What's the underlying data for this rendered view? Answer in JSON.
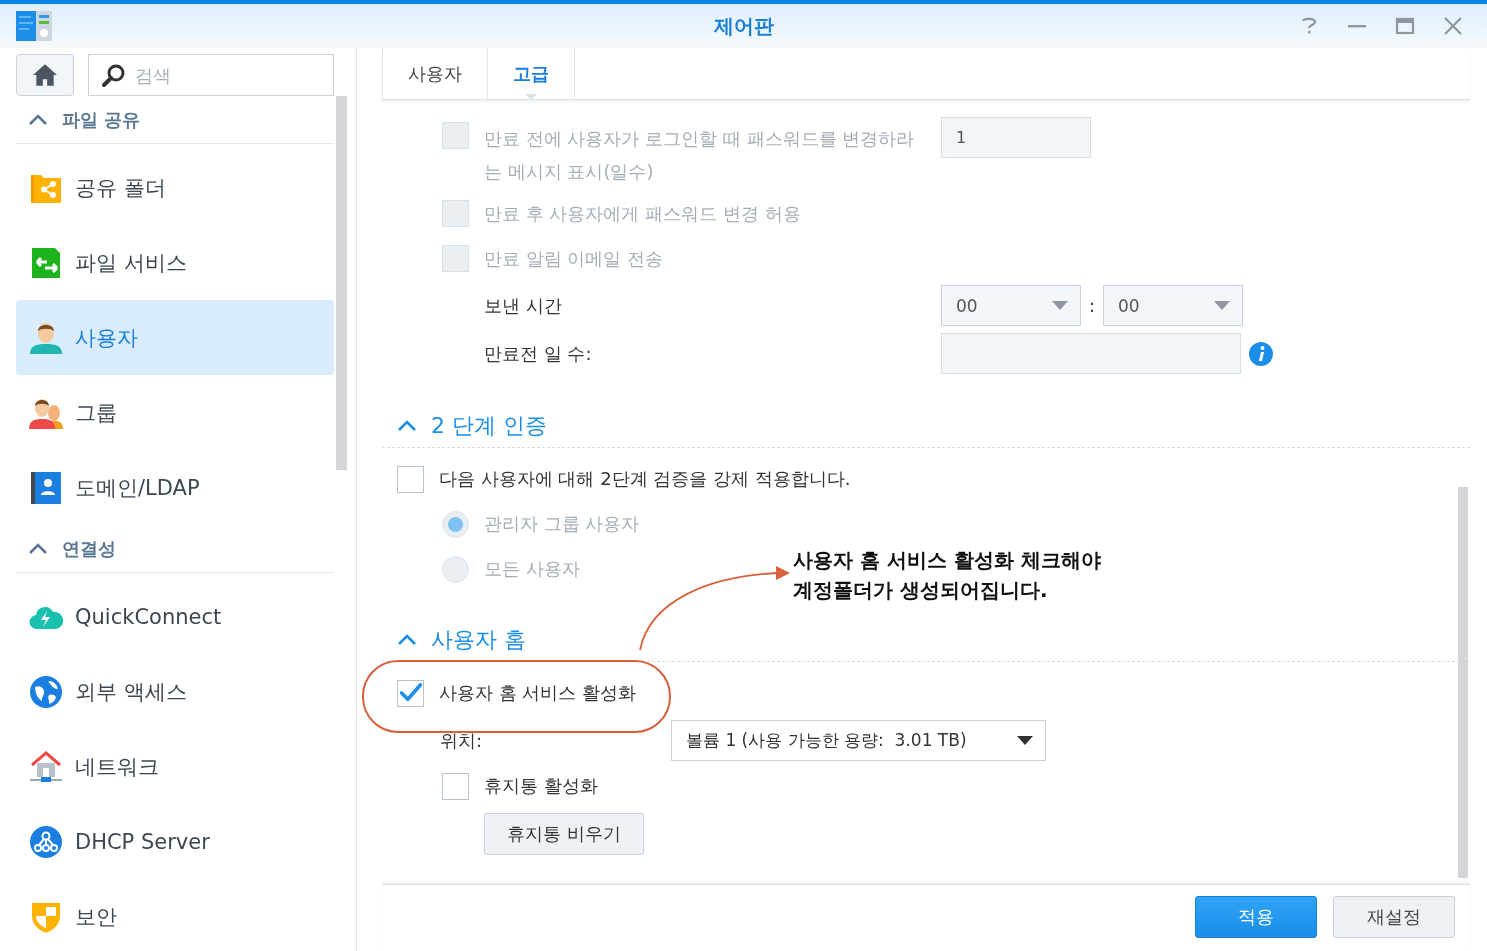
{
  "window": {
    "title": "제어판"
  },
  "sidebar": {
    "search": {
      "placeholder": "검색"
    },
    "sections": [
      {
        "title": "파일 공유",
        "expanded": true,
        "items": [
          {
            "label": "공유 폴더",
            "kind": "share-folder",
            "selected": false
          },
          {
            "label": "파일 서비스",
            "kind": "file-services",
            "selected": false
          },
          {
            "label": "사용자",
            "kind": "user",
            "selected": true
          },
          {
            "label": "그룹",
            "kind": "group",
            "selected": false
          },
          {
            "label": "도메인/LDAP",
            "kind": "directory",
            "selected": false
          }
        ]
      },
      {
        "title": "연결성",
        "expanded": true,
        "items": [
          {
            "label": "QuickConnect",
            "kind": "cloud",
            "selected": false
          },
          {
            "label": "외부 액세스",
            "kind": "globe",
            "selected": false
          },
          {
            "label": "네트워크",
            "kind": "network",
            "selected": false
          },
          {
            "label": "DHCP Server",
            "kind": "dhcp",
            "selected": false
          },
          {
            "label": "보안",
            "kind": "shield",
            "selected": false
          }
        ]
      }
    ]
  },
  "tabs": [
    {
      "label": "사용자",
      "selected": false
    },
    {
      "label": "고급",
      "selected": true
    }
  ],
  "expiry": {
    "options": [
      {
        "label": "만료 전에 사용자가 로그인할 때 패스워드를 변경하라는 메시지 표시(일수)",
        "checked": false,
        "disabled": true,
        "value": "1"
      },
      {
        "label": "만료 후 사용자에게 패스워드 변경 허용",
        "checked": false,
        "disabled": true
      },
      {
        "label": "만료 알림 이메일 전송",
        "checked": false,
        "disabled": true
      }
    ],
    "send_time": {
      "label": "보낸 시간",
      "hour": "00",
      "separator": ":",
      "minute": "00"
    },
    "days_before": {
      "label": "만료전 일 수:"
    }
  },
  "two_step": {
    "title": "2 단계 인증",
    "expanded": true,
    "enforce": {
      "label": "다음 사용자에 대해 2단계 검증을 강제 적용합니다.",
      "checked": false
    },
    "targets": [
      {
        "label": "관리자 그룹 사용자",
        "selected": true,
        "disabled": true
      },
      {
        "label": "모든 사용자",
        "selected": false,
        "disabled": true
      }
    ]
  },
  "user_home": {
    "title": "사용자 홈",
    "expanded": true,
    "enable": {
      "label": "사용자 홈 서비스 활성화",
      "checked": true
    },
    "location": {
      "label": "위치:",
      "value": "볼륨 1 (사용 가능한 용량:  3.01 TB)"
    },
    "recycle_bin": {
      "label": "휴지통 활성화",
      "checked": false
    },
    "empty_button": "휴지통 비우기"
  },
  "buttons": [
    {
      "label": "적용",
      "kind": "primary"
    },
    {
      "label": "재설정",
      "kind": "secondary"
    }
  ],
  "annotation": {
    "text": "사용자 홈 서비스 활성화 체크해야\n계정폴더가 생성되어집니다."
  }
}
